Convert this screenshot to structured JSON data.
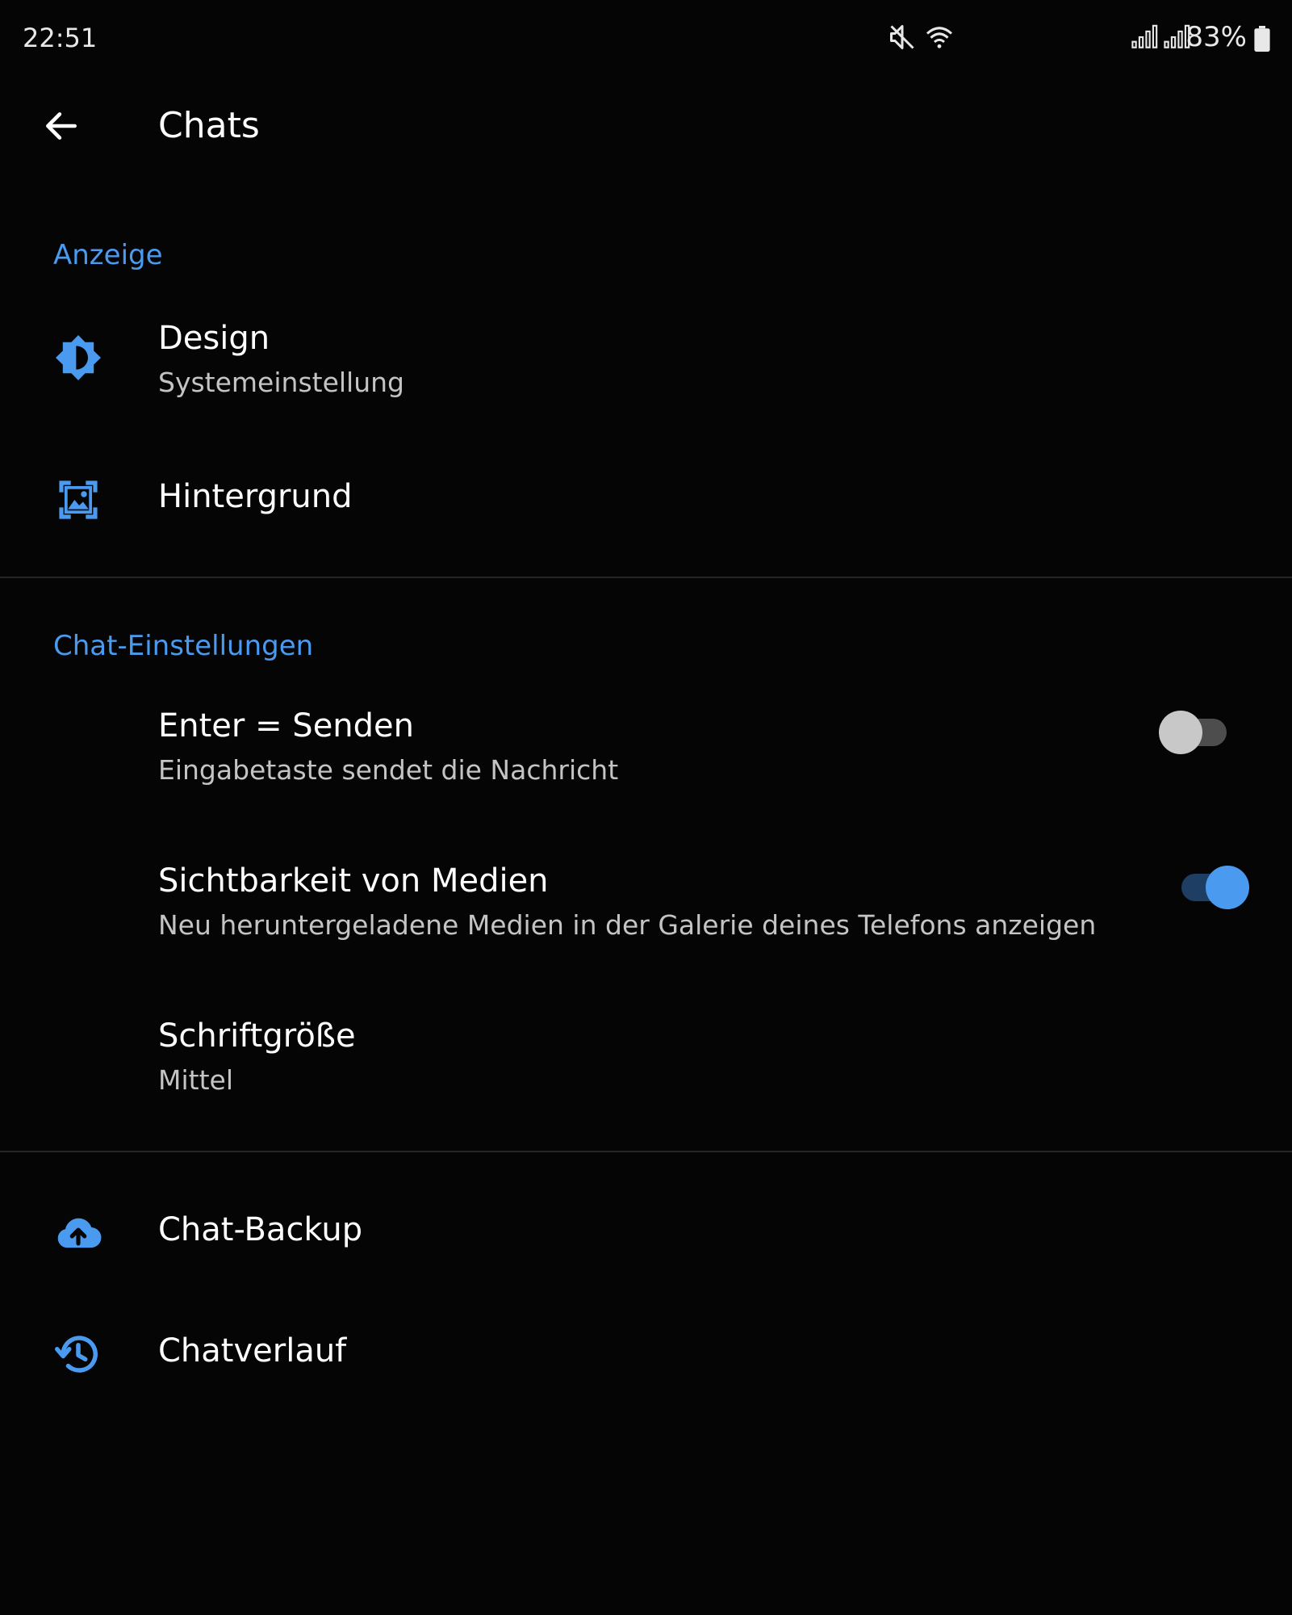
{
  "status_bar": {
    "time": "22:51",
    "battery": "83%",
    "icons": [
      "mute-icon",
      "wifi-icon",
      "signal-icon",
      "signal-icon",
      "battery-icon"
    ]
  },
  "app_bar": {
    "title": "Chats",
    "back_icon": "arrow-back-icon"
  },
  "sections": {
    "display": {
      "header": "Anzeige",
      "design": {
        "title": "Design",
        "subtitle": "Systemeinstellung",
        "icon": "brightness-icon"
      },
      "background": {
        "title": "Hintergrund",
        "icon": "wallpaper-icon"
      }
    },
    "chat_settings": {
      "header": "Chat-Einstellungen",
      "enter_send": {
        "title": "Enter = Senden",
        "subtitle": "Eingabetaste sendet die Nachricht",
        "enabled": false
      },
      "media_visibility": {
        "title": "Sichtbarkeit von Medien",
        "subtitle": "Neu heruntergeladene Medien in der Galerie deines Telefons anzeigen",
        "enabled": true
      },
      "font_size": {
        "title": "Schriftgröße",
        "subtitle": "Mittel"
      }
    },
    "other": {
      "backup": {
        "title": "Chat-Backup",
        "icon": "cloud-upload-icon"
      },
      "history": {
        "title": "Chatverlauf",
        "icon": "history-icon"
      }
    }
  },
  "colors": {
    "accent": "#4a9bf0",
    "background": "#050505",
    "text_primary": "#ffffff",
    "text_secondary": "#c4c4c4",
    "divider": "#262626"
  }
}
